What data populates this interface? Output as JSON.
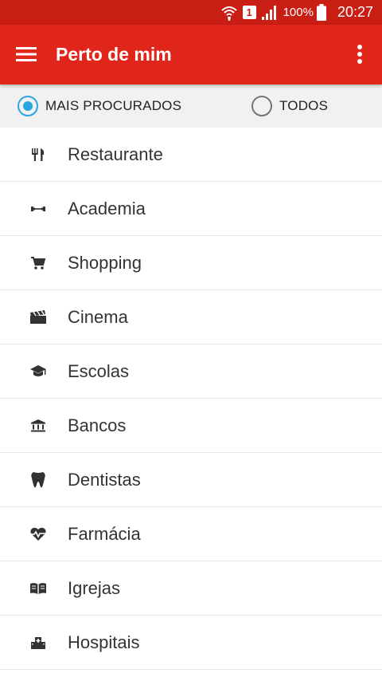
{
  "colors": {
    "status_bar": "#c81e14",
    "app_bar": "#e0261b",
    "radio_accent": "#29a6e1",
    "filter_bar_bg": "#f1f1f1",
    "divider": "#e6e6e6",
    "icon": "#333333"
  },
  "status_bar": {
    "sim_label": "1",
    "battery_percent": "100%",
    "time": "20:27",
    "icons": [
      "wifi-calling-icon",
      "sim-icon",
      "signal-icon",
      "battery-icon"
    ]
  },
  "app_bar": {
    "title": "Perto de mim",
    "menu_icon": "hamburger-menu-icon",
    "overflow_icon": "more-vert-icon"
  },
  "filter": {
    "options": [
      {
        "label": "MAIS PROCURADOS",
        "checked": true
      },
      {
        "label": "TODOS",
        "checked": false
      }
    ]
  },
  "categories": [
    {
      "label": "Restaurante",
      "icon": "restaurant-icon"
    },
    {
      "label": "Academia",
      "icon": "fitness-icon"
    },
    {
      "label": "Shopping",
      "icon": "shopping-cart-icon"
    },
    {
      "label": "Cinema",
      "icon": "movie-clapper-icon"
    },
    {
      "label": "Escolas",
      "icon": "school-icon"
    },
    {
      "label": "Bancos",
      "icon": "bank-icon"
    },
    {
      "label": "Dentistas",
      "icon": "tooth-icon"
    },
    {
      "label": "Farmácia",
      "icon": "heart-pulse-icon"
    },
    {
      "label": "Igrejas",
      "icon": "book-icon"
    },
    {
      "label": "Hospitais",
      "icon": "hospital-building-icon"
    }
  ]
}
